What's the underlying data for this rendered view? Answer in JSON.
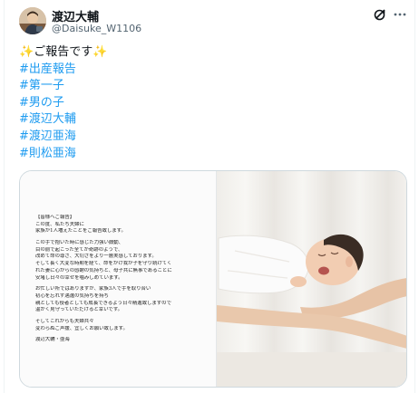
{
  "user": {
    "display_name": "渡辺大輔",
    "handle": "@Daisuke_W1106"
  },
  "icons": {
    "grok": "grok-icon",
    "more": "more-options-icon",
    "sparkle": "sparkles-emoji",
    "avatar": "profile-avatar"
  },
  "tweet": {
    "headline": "ご報告です",
    "hashtags": [
      "#出産報告",
      "#第一子",
      "#男の子",
      "#渡辺大輔",
      "#渡辺亜海",
      "#則松亜海"
    ]
  },
  "letter": {
    "lines": [
      "【皆様へご報告】",
      "この度、私たち夫婦に",
      "家族が1人増えたことをご報告致します。",
      "",
      "この手で抱いた時に感じた力強い鼓動、",
      "目の前で起こった全てが奇跡のようで、",
      "改めて命の尊さ、大切さをより一層実感しております。",
      "そして長く大変な時期を経て、命をかけ我が子を守り続けてく",
      "れた妻に心からの感謝の気持ちと、母子共に無事であることに",
      "安堵し日々の幸せを噛みしめています。",
      "",
      "お忙しい所ではありますが、家族3人で手を取り合い",
      "初心を忘れず邁進の気持ちを持ち",
      "親としても役者としても成長できるよう日々精進致しますので",
      "温かく見守っていただけると幸いです。",
      "",
      "そしてこれからも夫婦共々",
      "変わらぬご声援、宜しくお願い致します。",
      "",
      "渡辺大輔・亜海"
    ]
  },
  "colors": {
    "hashtag": "#1d9bf0",
    "text": "#0f1419",
    "secondary": "#536471",
    "border": "#cfd9de"
  }
}
